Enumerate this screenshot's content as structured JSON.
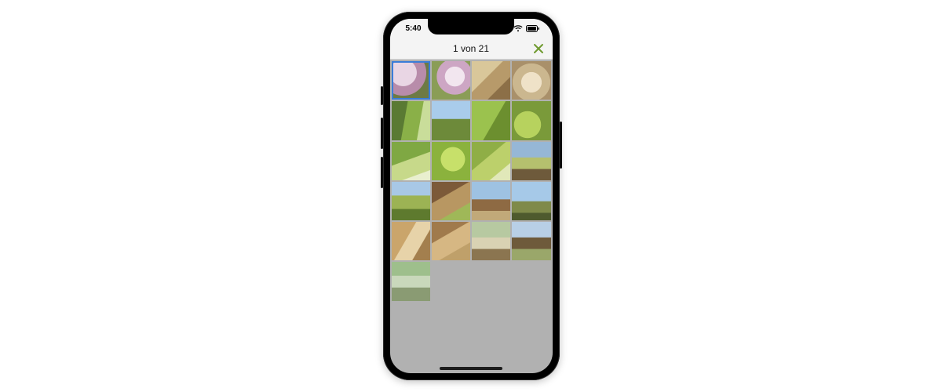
{
  "status": {
    "time": "5:40",
    "wifi_icon": "wifi-icon",
    "battery_icon": "battery-icon"
  },
  "header": {
    "title": "1 von 21",
    "close_icon": "close-icon",
    "close_color": "#6f9a2f"
  },
  "grid": {
    "columns": 4,
    "selected_index": 0,
    "items": [
      {
        "name": "thumb-1"
      },
      {
        "name": "thumb-2"
      },
      {
        "name": "thumb-3"
      },
      {
        "name": "thumb-4"
      },
      {
        "name": "thumb-5"
      },
      {
        "name": "thumb-6"
      },
      {
        "name": "thumb-7"
      },
      {
        "name": "thumb-8"
      },
      {
        "name": "thumb-9"
      },
      {
        "name": "thumb-10"
      },
      {
        "name": "thumb-11"
      },
      {
        "name": "thumb-12"
      },
      {
        "name": "thumb-13"
      },
      {
        "name": "thumb-14"
      },
      {
        "name": "thumb-15"
      },
      {
        "name": "thumb-16"
      },
      {
        "name": "thumb-17"
      },
      {
        "name": "thumb-18"
      },
      {
        "name": "thumb-19"
      },
      {
        "name": "thumb-20"
      },
      {
        "name": "thumb-21"
      }
    ]
  }
}
